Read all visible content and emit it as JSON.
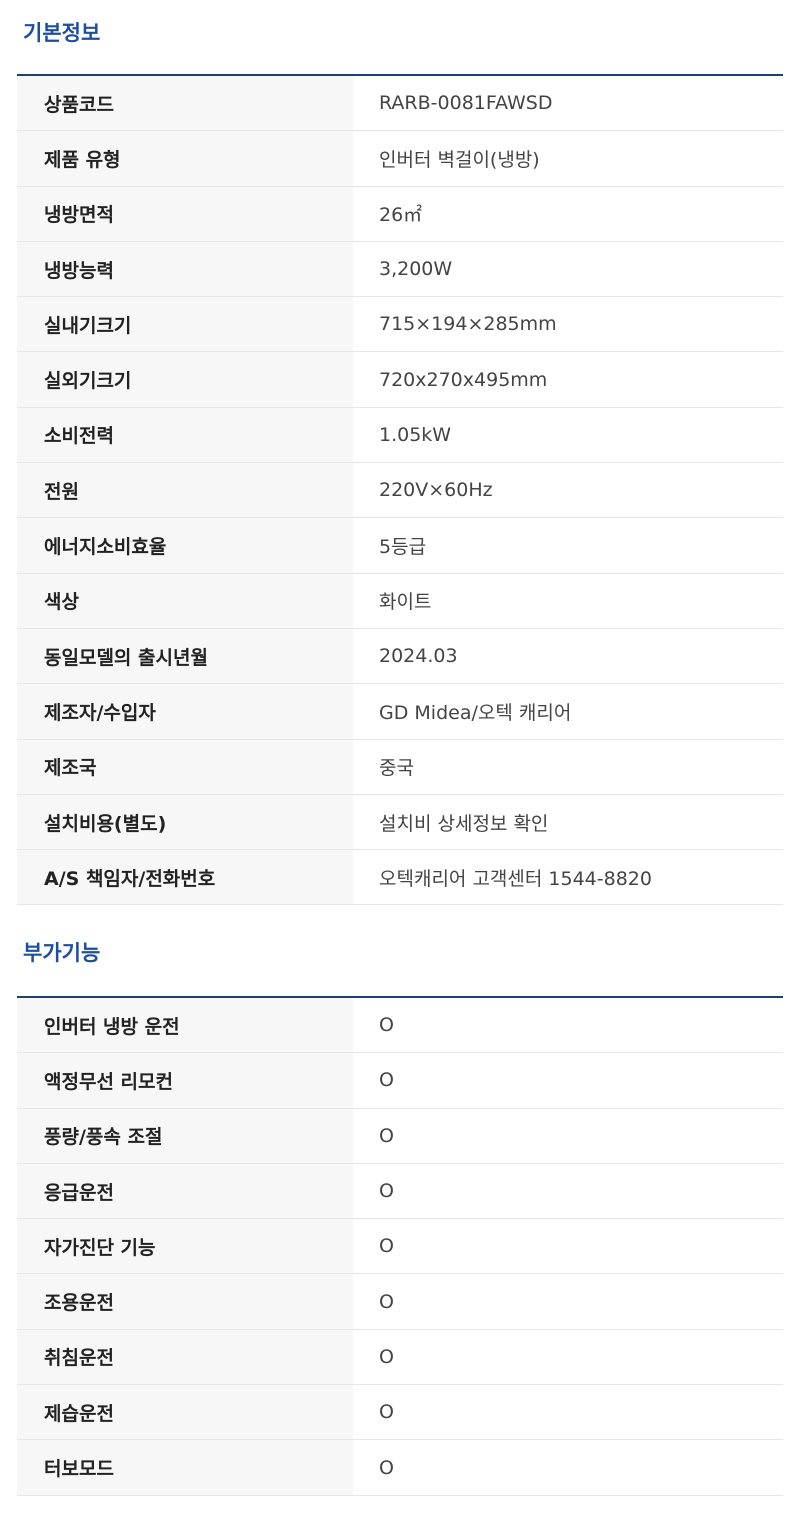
{
  "basic": {
    "title": "기본정보",
    "rows": [
      {
        "label": "상품코드",
        "value": "RARB-0081FAWSD"
      },
      {
        "label": "제품 유형",
        "value": "인버터 벽걸이(냉방)"
      },
      {
        "label": "냉방면적",
        "value": "26㎡"
      },
      {
        "label": "냉방능력",
        "value": "3,200W"
      },
      {
        "label": "실내기크기",
        "value": "715×194×285mm"
      },
      {
        "label": "실외기크기",
        "value": "720x270x495mm"
      },
      {
        "label": "소비전력",
        "value": "1.05kW"
      },
      {
        "label": "전원",
        "value": "220V×60Hz"
      },
      {
        "label": "에너지소비효율",
        "value": "5등급"
      },
      {
        "label": "색상",
        "value": "화이트"
      },
      {
        "label": "동일모델의 출시년월",
        "value": "2024.03"
      },
      {
        "label": "제조자/수입자",
        "value": "GD Midea/오텍 캐리어"
      },
      {
        "label": "제조국",
        "value": "중국"
      },
      {
        "label": "설치비용(별도)",
        "value": "설치비 상세정보 확인"
      },
      {
        "label": "A/S 책임자/전화번호",
        "value": "오텍캐리어 고객센터 1544-8820"
      }
    ]
  },
  "extra": {
    "title": "부가기능",
    "rows": [
      {
        "label": "인버터 냉방 운전",
        "value": "O"
      },
      {
        "label": "액정무선 리모컨",
        "value": "O"
      },
      {
        "label": "풍량/풍속 조절",
        "value": "O"
      },
      {
        "label": "응급운전",
        "value": "O"
      },
      {
        "label": "자가진단 기능",
        "value": "O"
      },
      {
        "label": "조용운전",
        "value": "O"
      },
      {
        "label": "취침운전",
        "value": "O"
      },
      {
        "label": "제습운전",
        "value": "O"
      },
      {
        "label": "터보모드",
        "value": "O"
      }
    ]
  }
}
